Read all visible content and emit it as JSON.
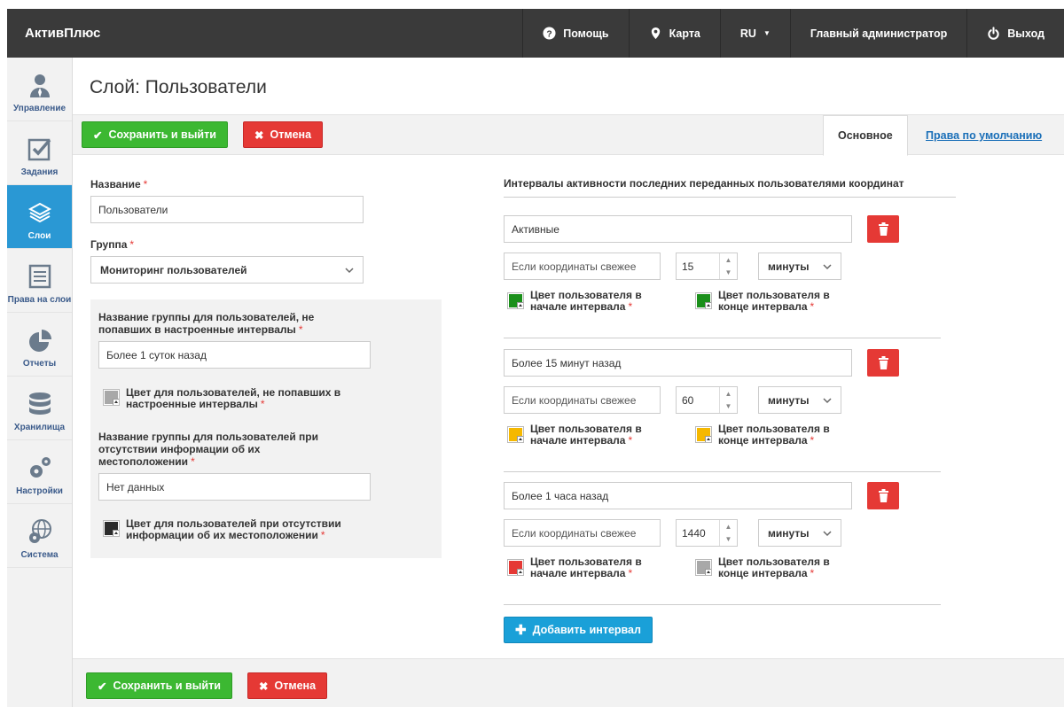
{
  "app": {
    "brand": "АктивПлюс"
  },
  "topnav": {
    "help": "Помощь",
    "map": "Карта",
    "lang": "RU",
    "user": "Главный администратор",
    "logout": "Выход"
  },
  "sidebar": {
    "items": [
      {
        "label": "Управление",
        "icon": "user-icon"
      },
      {
        "label": "Задания",
        "icon": "checkbox-icon"
      },
      {
        "label": "Слои",
        "icon": "layers-icon"
      },
      {
        "label": "Права на слои",
        "icon": "list-icon"
      },
      {
        "label": "Отчеты",
        "icon": "pie-chart-icon"
      },
      {
        "label": "Хранилища",
        "icon": "database-icon"
      },
      {
        "label": "Настройки",
        "icon": "gears-icon"
      },
      {
        "label": "Система",
        "icon": "globe-gear-icon"
      }
    ]
  },
  "page": {
    "title": "Слой: Пользователи"
  },
  "toolbar": {
    "save": "Сохранить и выйти",
    "cancel": "Отмена",
    "tab_main": "Основное",
    "tab_rights": "Права по умолчанию"
  },
  "form": {
    "name_label": "Название",
    "name_value": "Пользователи",
    "group_label": "Группа",
    "group_value": "Мониторинг пользователей",
    "outside_label_1": "Название группы для пользователей, не",
    "outside_label_2": "попавших в настроенные интервалы",
    "outside_value": "Более 1 суток назад",
    "outside_color_1": "Цвет для пользователей, не попавших в",
    "outside_color_2": "настроенные интервалы",
    "outside_color": "#a8a8a8",
    "nodata_label_1": "Название группы для пользователей при",
    "nodata_label_2": "отсутствии информации об их",
    "nodata_label_3": "местоположении",
    "nodata_value": "Нет данных",
    "nodata_color_1": "Цвет для пользователей при отсутствии",
    "nodata_color_2": "информации об их местоположении",
    "nodata_color": "#2b2b2b"
  },
  "intervals": {
    "heading": "Интервалы активности последних переданных пользователями координат",
    "fresher_placeholder": "Если координаты свежее",
    "unit": "минуты",
    "start_1": "Цвет пользователя в",
    "start_2": "начале интервала",
    "end_1": "Цвет пользователя в",
    "end_2": "конце интервала",
    "add": "Добавить интервал",
    "items": [
      {
        "name": "Активные",
        "value": "15",
        "start_color": "#1a8f1a",
        "end_color": "#1a8f1a"
      },
      {
        "name": "Более 15 минут назад",
        "value": "60",
        "start_color": "#f5b800",
        "end_color": "#f5b800"
      },
      {
        "name": "Более 1 часа назад",
        "value": "1440",
        "start_color": "#e53935",
        "end_color": "#a8a8a8"
      }
    ]
  },
  "bottom": {
    "save": "Сохранить и выйти",
    "cancel": "Отмена"
  }
}
